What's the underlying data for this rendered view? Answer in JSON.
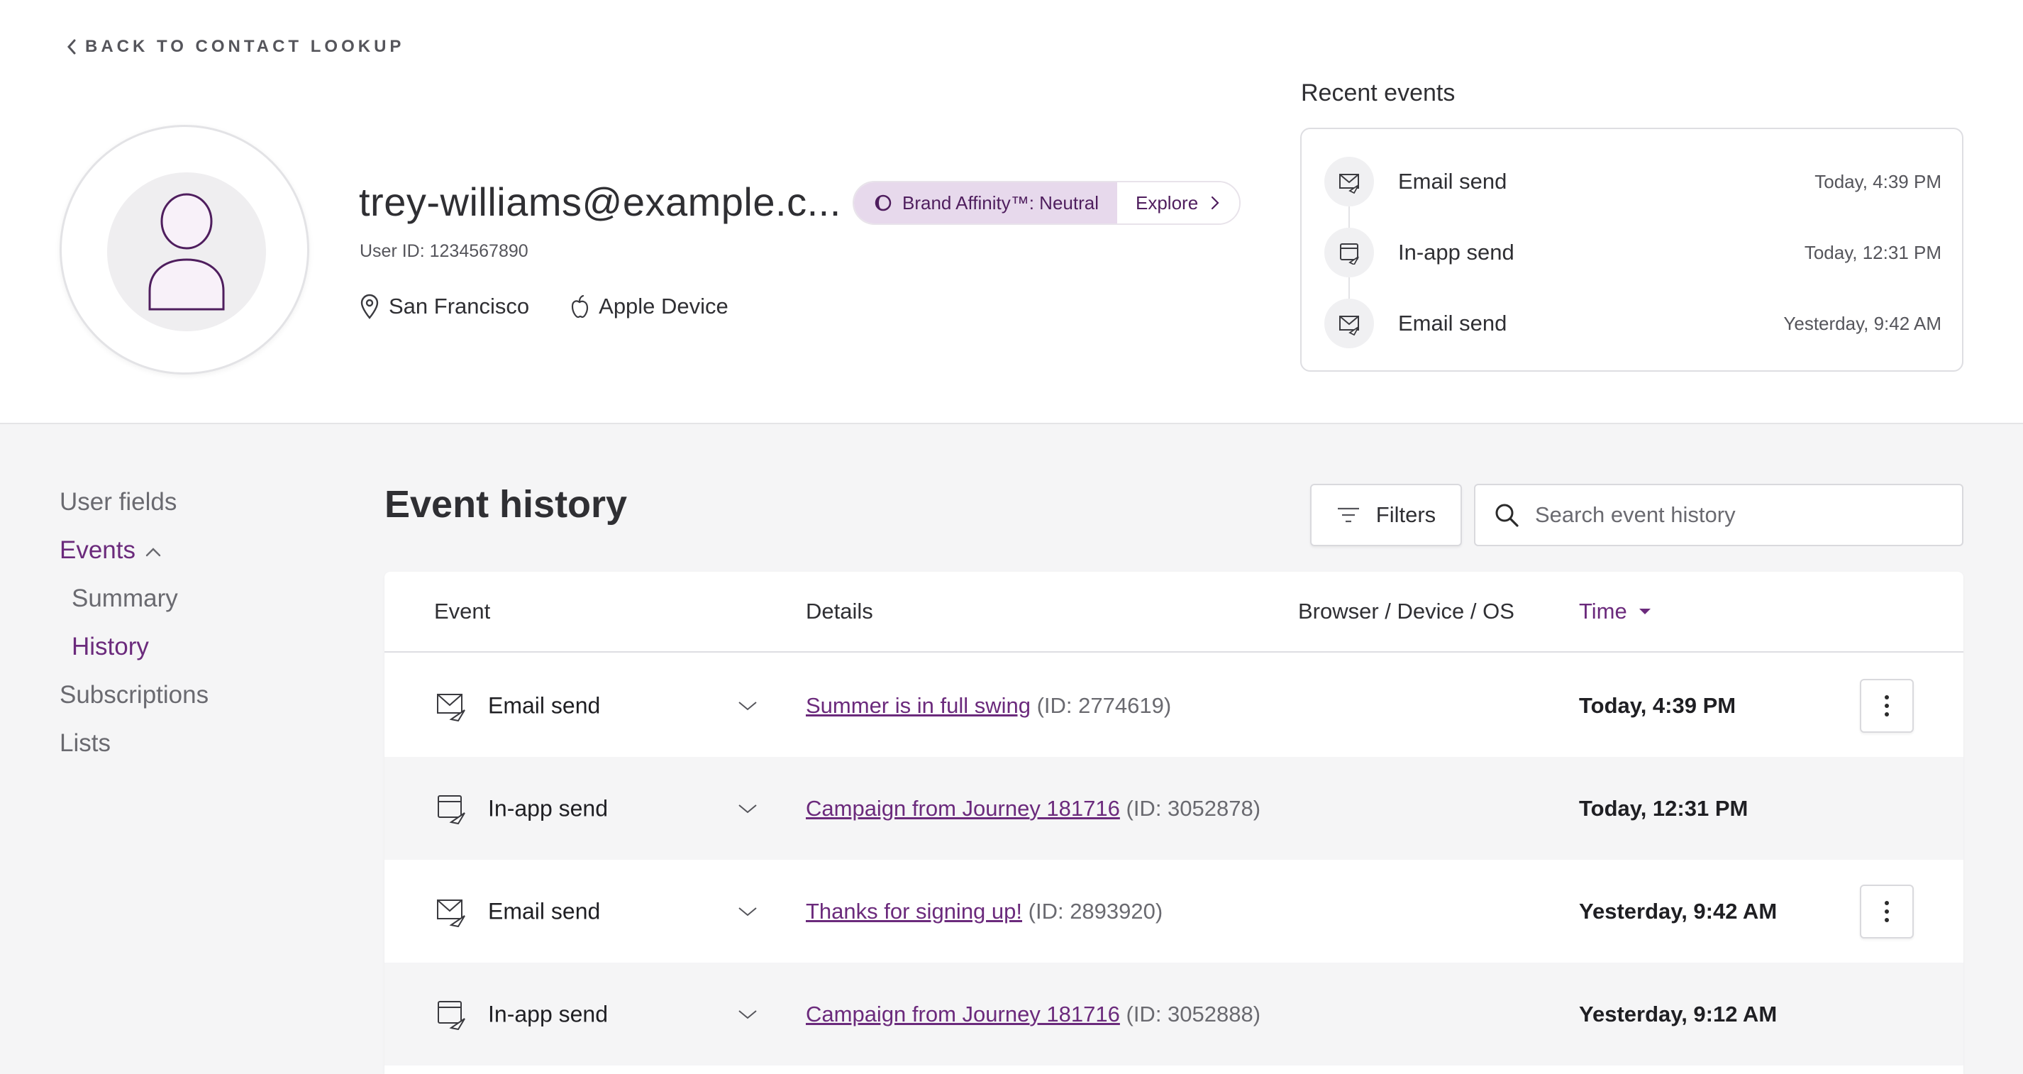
{
  "header": {
    "back_label": "BACK TO CONTACT LOOKUP",
    "email": "trey-williams@example.c...",
    "user_id": "User ID: 1234567890",
    "location": "San Francisco",
    "device": "Apple Device",
    "brand_affinity": "Brand Affinity™: Neutral",
    "explore_label": "Explore"
  },
  "recent": {
    "title": "Recent events",
    "items": [
      {
        "name": "Email send",
        "time": "Today, 4:39 PM",
        "icon": "email-send-icon"
      },
      {
        "name": "In-app send",
        "time": "Today, 12:31 PM",
        "icon": "in-app-send-icon"
      },
      {
        "name": "Email send",
        "time": "Yesterday, 9:42 AM",
        "icon": "email-send-icon"
      }
    ]
  },
  "nav": {
    "user_fields": "User fields",
    "events": "Events",
    "summary": "Summary",
    "history": "History",
    "subscriptions": "Subscriptions",
    "lists": "Lists"
  },
  "main": {
    "title": "Event history",
    "filters_label": "Filters",
    "search_placeholder": "Search event history"
  },
  "table": {
    "headers": {
      "event": "Event",
      "details": "Details",
      "device": "Browser / Device / OS",
      "time": "Time"
    },
    "rows": [
      {
        "event": "Email send",
        "icon": "email-send-icon",
        "link": "Summer is in full swing",
        "id": "(ID: 2774619)",
        "time": "Today, 4:39 PM",
        "has_menu": true
      },
      {
        "event": "In-app send",
        "icon": "in-app-send-icon",
        "link": "Campaign from Journey 181716",
        "id": "(ID: 3052878)",
        "time": "Today, 12:31 PM",
        "has_menu": false
      },
      {
        "event": "Email send",
        "icon": "email-send-icon",
        "link": "Thanks for signing up!",
        "id": "(ID: 2893920)",
        "time": "Yesterday, 9:42 AM",
        "has_menu": true
      },
      {
        "event": "In-app send",
        "icon": "in-app-send-icon",
        "link": "Campaign from Journey 181716",
        "id": "(ID: 3052888)",
        "time": "Yesterday, 9:12 AM",
        "has_menu": false
      }
    ]
  },
  "colors": {
    "accent": "#6b2a7c",
    "affinity_bg": "#e7d9ec",
    "page_bg": "#f5f5f6"
  }
}
